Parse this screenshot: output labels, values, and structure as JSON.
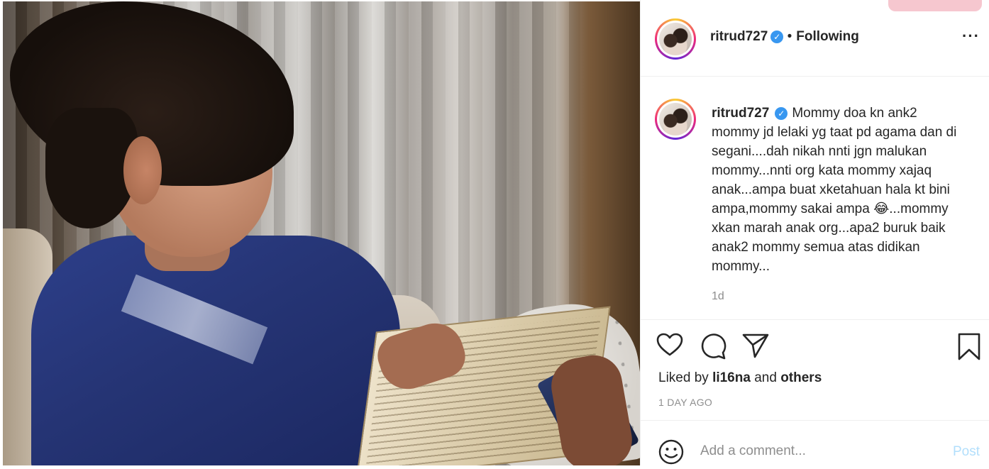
{
  "post": {
    "image_alt": "Boy reading a book",
    "author": {
      "username": "ritrud727",
      "verified": true,
      "follow_status": "Following"
    },
    "caption": {
      "username": "ritrud727",
      "text": "Mommy doa kn ank2 mommy jd lelaki yg taat pd agama dan di segani....dah nikah nnti jgn malukan mommy...nnti org kata mommy xajaq anak...ampa buat xketahuan hala kt bini ampa,mommy sakai ampa 😂...mommy xkan marah anak org...apa2 buruk baik anak2 mommy semua atas didikan mommy...",
      "time": "1d"
    },
    "likes": {
      "prefix": "Liked by",
      "user": "li16na",
      "conjunction": "and",
      "others": "others"
    },
    "date": "1 DAY AGO",
    "comment_box": {
      "placeholder": "Add a comment...",
      "post_label": "Post"
    }
  },
  "icons": {
    "more": "more-icon",
    "heart": "heart-icon",
    "comment": "comment-icon",
    "share": "share-icon",
    "bookmark": "bookmark-icon",
    "emoji": "emoji-icon",
    "verified": "verified-badge-icon"
  },
  "colors": {
    "verified_blue": "#3897f0",
    "muted_text": "#8e8e8e",
    "post_button_disabled": "#b2dffc"
  }
}
